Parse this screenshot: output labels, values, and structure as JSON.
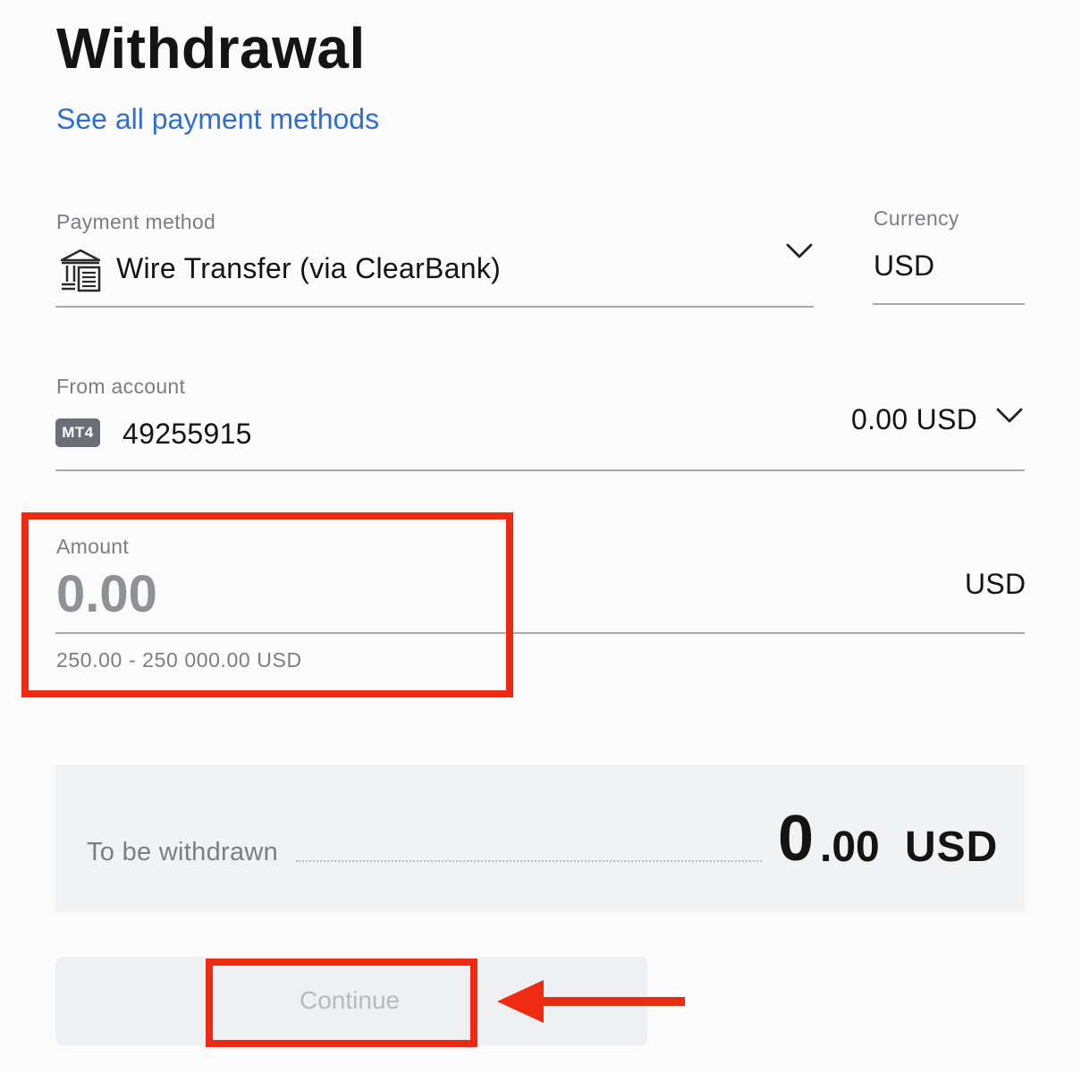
{
  "header": {
    "title": "Withdrawal",
    "link_label": "See all payment methods"
  },
  "payment_method": {
    "label": "Payment method",
    "value": "Wire Transfer (via ClearBank)",
    "icon": "bank-icon"
  },
  "currency": {
    "label": "Currency",
    "value": "USD"
  },
  "from_account": {
    "label": "From account",
    "badge": "MT4",
    "account_number": "49255915",
    "balance": "0.00 USD"
  },
  "amount": {
    "label": "Amount",
    "placeholder": "0.00",
    "currency": "USD",
    "limits": "250.00 - 250 000.00 USD"
  },
  "summary": {
    "label": "To be withdrawn",
    "amount_integer": "0",
    "amount_decimal": ".00",
    "currency": "USD"
  },
  "actions": {
    "continue_label": "Continue"
  },
  "annotations": {
    "highlight_color": "#ee2b12",
    "arrow_icon": "arrow-left-icon"
  },
  "colors": {
    "link": "#2f6fd0",
    "text": "#141414",
    "muted": "#7b7e82"
  }
}
